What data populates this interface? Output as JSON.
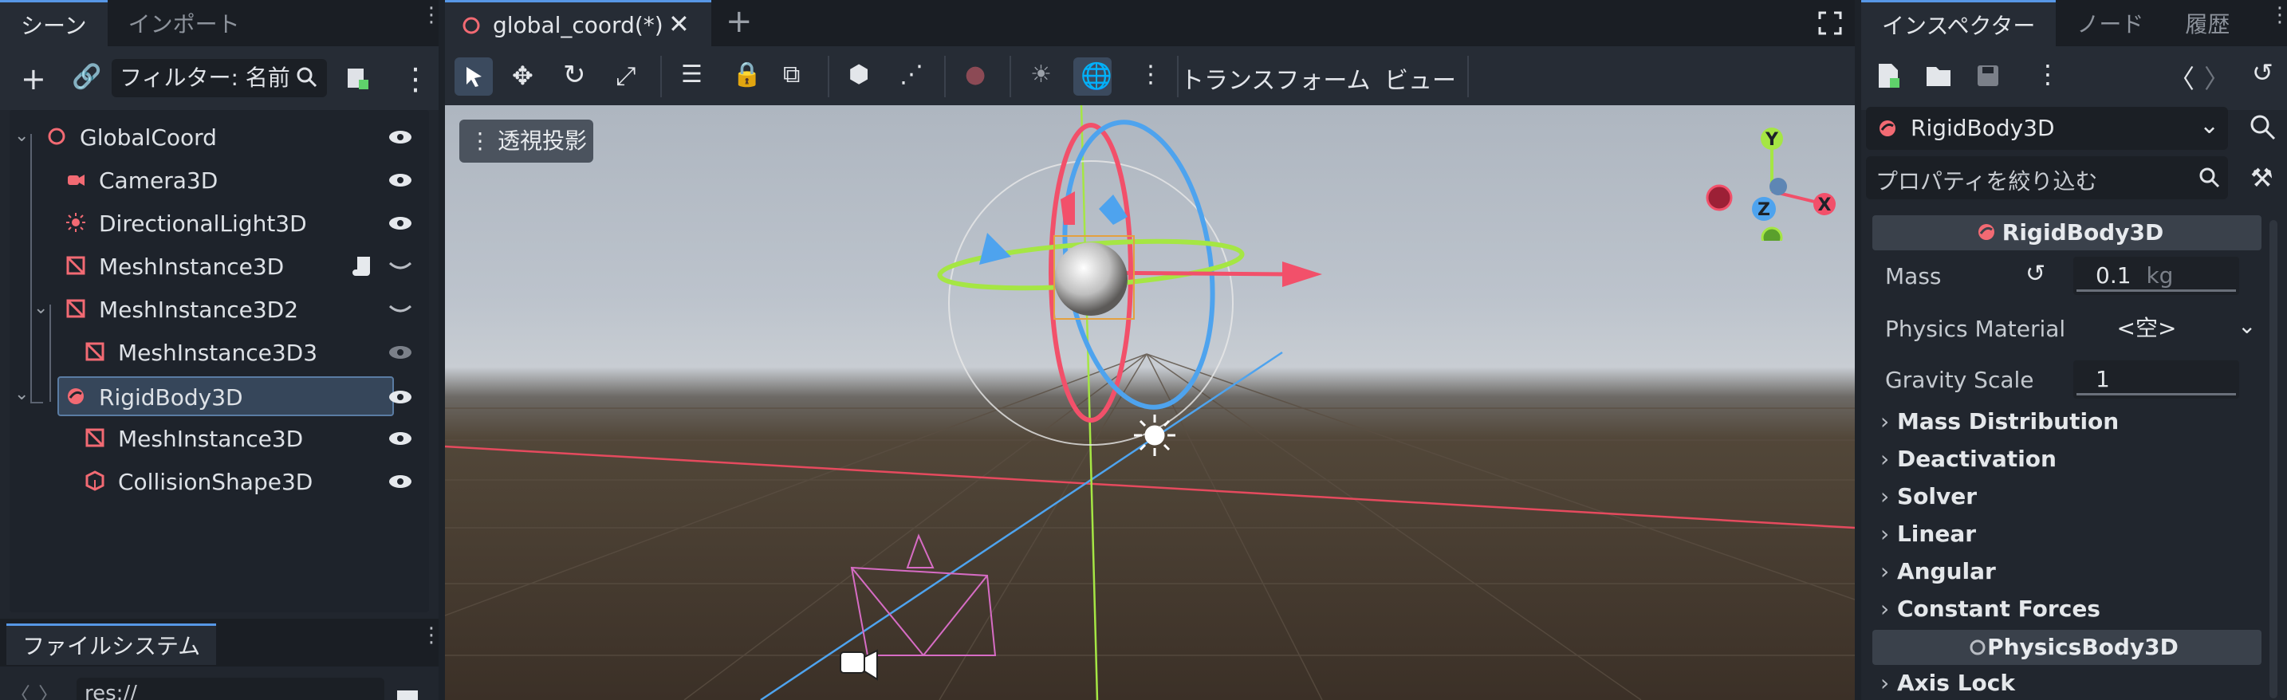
{
  "left_dock": {
    "tabs": [
      "シーン",
      "インポート"
    ],
    "filter_placeholder": "フィルター: 名前",
    "tree": [
      {
        "label": "GlobalCoord"
      },
      {
        "label": "Camera3D"
      },
      {
        "label": "DirectionalLight3D"
      },
      {
        "label": "MeshInstance3D"
      },
      {
        "label": "MeshInstance3D2"
      },
      {
        "label": "MeshInstance3D3"
      },
      {
        "label": "RigidBody3D"
      },
      {
        "label": "MeshInstance3D"
      },
      {
        "label": "CollisionShape3D"
      }
    ],
    "filesystem_tab": "ファイルシステム",
    "path": "res://"
  },
  "editor": {
    "doc_tab": "global_coord(*)",
    "menus": [
      "トランスフォーム",
      "ビュー"
    ],
    "perspective_label": "透視投影",
    "gizmo_axes": [
      "Y",
      "Z",
      "X"
    ]
  },
  "inspector": {
    "tabs": [
      "インスペクター",
      "ノード",
      "履歴"
    ],
    "selected_node": "RigidBody3D",
    "filter_placeholder": "プロパティを絞り込む",
    "section_title": "RigidBody3D",
    "props": {
      "mass_label": "Mass",
      "mass_value": "0.1",
      "mass_unit": "kg",
      "physics_material_label": "Physics Material",
      "physics_material_value": "<空>",
      "gravity_scale_label": "Gravity Scale",
      "gravity_scale_value": "1"
    },
    "groups": [
      "Mass Distribution",
      "Deactivation",
      "Solver",
      "Linear",
      "Angular",
      "Constant Forces"
    ],
    "section2_title": "PhysicsBody3D",
    "groups2": [
      "Axis Lock"
    ]
  },
  "colors": {
    "accent": "#5797e6",
    "node_red": "#f26a73",
    "axis_x": "#f4506a",
    "axis_y": "#a5e644",
    "axis_z": "#4ea3ee"
  }
}
